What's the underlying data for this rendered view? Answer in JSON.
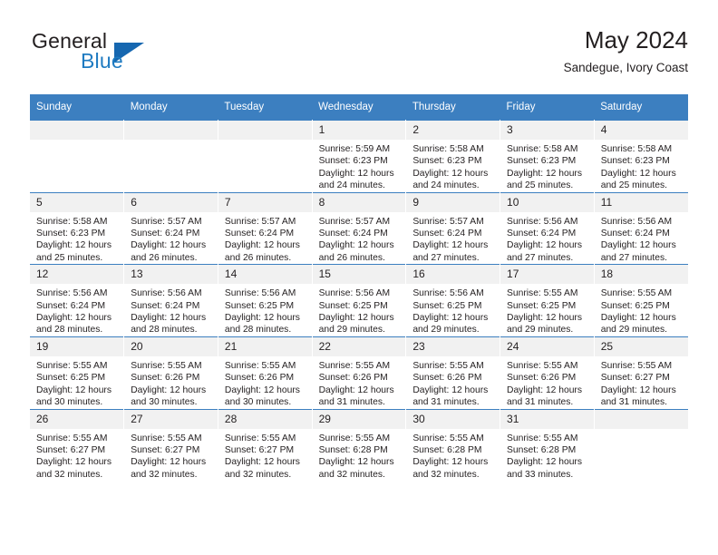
{
  "brand": {
    "name_top": "General",
    "name_bottom": "Blue",
    "accent_color": "#1f7bc1",
    "triangle_color": "#1667b0"
  },
  "header": {
    "title": "May 2024",
    "subtitle": "Sandegue, Ivory Coast"
  },
  "calendar": {
    "header_color": "#3c7fc0",
    "daynum_bg": "#f1f1f1",
    "weekday_headers": [
      "Sunday",
      "Monday",
      "Tuesday",
      "Wednesday",
      "Thursday",
      "Friday",
      "Saturday"
    ],
    "weeks": [
      [
        {
          "day": "",
          "empty": true,
          "sunrise": "",
          "sunset": "",
          "daylight_line1": "",
          "daylight_line2": ""
        },
        {
          "day": "",
          "empty": true,
          "sunrise": "",
          "sunset": "",
          "daylight_line1": "",
          "daylight_line2": ""
        },
        {
          "day": "",
          "empty": true,
          "sunrise": "",
          "sunset": "",
          "daylight_line1": "",
          "daylight_line2": ""
        },
        {
          "day": "1",
          "empty": false,
          "sunrise": "Sunrise: 5:59 AM",
          "sunset": "Sunset: 6:23 PM",
          "daylight_line1": "Daylight: 12 hours",
          "daylight_line2": "and 24 minutes."
        },
        {
          "day": "2",
          "empty": false,
          "sunrise": "Sunrise: 5:58 AM",
          "sunset": "Sunset: 6:23 PM",
          "daylight_line1": "Daylight: 12 hours",
          "daylight_line2": "and 24 minutes."
        },
        {
          "day": "3",
          "empty": false,
          "sunrise": "Sunrise: 5:58 AM",
          "sunset": "Sunset: 6:23 PM",
          "daylight_line1": "Daylight: 12 hours",
          "daylight_line2": "and 25 minutes."
        },
        {
          "day": "4",
          "empty": false,
          "sunrise": "Sunrise: 5:58 AM",
          "sunset": "Sunset: 6:23 PM",
          "daylight_line1": "Daylight: 12 hours",
          "daylight_line2": "and 25 minutes."
        }
      ],
      [
        {
          "day": "5",
          "empty": false,
          "sunrise": "Sunrise: 5:58 AM",
          "sunset": "Sunset: 6:23 PM",
          "daylight_line1": "Daylight: 12 hours",
          "daylight_line2": "and 25 minutes."
        },
        {
          "day": "6",
          "empty": false,
          "sunrise": "Sunrise: 5:57 AM",
          "sunset": "Sunset: 6:24 PM",
          "daylight_line1": "Daylight: 12 hours",
          "daylight_line2": "and 26 minutes."
        },
        {
          "day": "7",
          "empty": false,
          "sunrise": "Sunrise: 5:57 AM",
          "sunset": "Sunset: 6:24 PM",
          "daylight_line1": "Daylight: 12 hours",
          "daylight_line2": "and 26 minutes."
        },
        {
          "day": "8",
          "empty": false,
          "sunrise": "Sunrise: 5:57 AM",
          "sunset": "Sunset: 6:24 PM",
          "daylight_line1": "Daylight: 12 hours",
          "daylight_line2": "and 26 minutes."
        },
        {
          "day": "9",
          "empty": false,
          "sunrise": "Sunrise: 5:57 AM",
          "sunset": "Sunset: 6:24 PM",
          "daylight_line1": "Daylight: 12 hours",
          "daylight_line2": "and 27 minutes."
        },
        {
          "day": "10",
          "empty": false,
          "sunrise": "Sunrise: 5:56 AM",
          "sunset": "Sunset: 6:24 PM",
          "daylight_line1": "Daylight: 12 hours",
          "daylight_line2": "and 27 minutes."
        },
        {
          "day": "11",
          "empty": false,
          "sunrise": "Sunrise: 5:56 AM",
          "sunset": "Sunset: 6:24 PM",
          "daylight_line1": "Daylight: 12 hours",
          "daylight_line2": "and 27 minutes."
        }
      ],
      [
        {
          "day": "12",
          "empty": false,
          "sunrise": "Sunrise: 5:56 AM",
          "sunset": "Sunset: 6:24 PM",
          "daylight_line1": "Daylight: 12 hours",
          "daylight_line2": "and 28 minutes."
        },
        {
          "day": "13",
          "empty": false,
          "sunrise": "Sunrise: 5:56 AM",
          "sunset": "Sunset: 6:24 PM",
          "daylight_line1": "Daylight: 12 hours",
          "daylight_line2": "and 28 minutes."
        },
        {
          "day": "14",
          "empty": false,
          "sunrise": "Sunrise: 5:56 AM",
          "sunset": "Sunset: 6:25 PM",
          "daylight_line1": "Daylight: 12 hours",
          "daylight_line2": "and 28 minutes."
        },
        {
          "day": "15",
          "empty": false,
          "sunrise": "Sunrise: 5:56 AM",
          "sunset": "Sunset: 6:25 PM",
          "daylight_line1": "Daylight: 12 hours",
          "daylight_line2": "and 29 minutes."
        },
        {
          "day": "16",
          "empty": false,
          "sunrise": "Sunrise: 5:56 AM",
          "sunset": "Sunset: 6:25 PM",
          "daylight_line1": "Daylight: 12 hours",
          "daylight_line2": "and 29 minutes."
        },
        {
          "day": "17",
          "empty": false,
          "sunrise": "Sunrise: 5:55 AM",
          "sunset": "Sunset: 6:25 PM",
          "daylight_line1": "Daylight: 12 hours",
          "daylight_line2": "and 29 minutes."
        },
        {
          "day": "18",
          "empty": false,
          "sunrise": "Sunrise: 5:55 AM",
          "sunset": "Sunset: 6:25 PM",
          "daylight_line1": "Daylight: 12 hours",
          "daylight_line2": "and 29 minutes."
        }
      ],
      [
        {
          "day": "19",
          "empty": false,
          "sunrise": "Sunrise: 5:55 AM",
          "sunset": "Sunset: 6:25 PM",
          "daylight_line1": "Daylight: 12 hours",
          "daylight_line2": "and 30 minutes."
        },
        {
          "day": "20",
          "empty": false,
          "sunrise": "Sunrise: 5:55 AM",
          "sunset": "Sunset: 6:26 PM",
          "daylight_line1": "Daylight: 12 hours",
          "daylight_line2": "and 30 minutes."
        },
        {
          "day": "21",
          "empty": false,
          "sunrise": "Sunrise: 5:55 AM",
          "sunset": "Sunset: 6:26 PM",
          "daylight_line1": "Daylight: 12 hours",
          "daylight_line2": "and 30 minutes."
        },
        {
          "day": "22",
          "empty": false,
          "sunrise": "Sunrise: 5:55 AM",
          "sunset": "Sunset: 6:26 PM",
          "daylight_line1": "Daylight: 12 hours",
          "daylight_line2": "and 31 minutes."
        },
        {
          "day": "23",
          "empty": false,
          "sunrise": "Sunrise: 5:55 AM",
          "sunset": "Sunset: 6:26 PM",
          "daylight_line1": "Daylight: 12 hours",
          "daylight_line2": "and 31 minutes."
        },
        {
          "day": "24",
          "empty": false,
          "sunrise": "Sunrise: 5:55 AM",
          "sunset": "Sunset: 6:26 PM",
          "daylight_line1": "Daylight: 12 hours",
          "daylight_line2": "and 31 minutes."
        },
        {
          "day": "25",
          "empty": false,
          "sunrise": "Sunrise: 5:55 AM",
          "sunset": "Sunset: 6:27 PM",
          "daylight_line1": "Daylight: 12 hours",
          "daylight_line2": "and 31 minutes."
        }
      ],
      [
        {
          "day": "26",
          "empty": false,
          "sunrise": "Sunrise: 5:55 AM",
          "sunset": "Sunset: 6:27 PM",
          "daylight_line1": "Daylight: 12 hours",
          "daylight_line2": "and 32 minutes."
        },
        {
          "day": "27",
          "empty": false,
          "sunrise": "Sunrise: 5:55 AM",
          "sunset": "Sunset: 6:27 PM",
          "daylight_line1": "Daylight: 12 hours",
          "daylight_line2": "and 32 minutes."
        },
        {
          "day": "28",
          "empty": false,
          "sunrise": "Sunrise: 5:55 AM",
          "sunset": "Sunset: 6:27 PM",
          "daylight_line1": "Daylight: 12 hours",
          "daylight_line2": "and 32 minutes."
        },
        {
          "day": "29",
          "empty": false,
          "sunrise": "Sunrise: 5:55 AM",
          "sunset": "Sunset: 6:28 PM",
          "daylight_line1": "Daylight: 12 hours",
          "daylight_line2": "and 32 minutes."
        },
        {
          "day": "30",
          "empty": false,
          "sunrise": "Sunrise: 5:55 AM",
          "sunset": "Sunset: 6:28 PM",
          "daylight_line1": "Daylight: 12 hours",
          "daylight_line2": "and 32 minutes."
        },
        {
          "day": "31",
          "empty": false,
          "sunrise": "Sunrise: 5:55 AM",
          "sunset": "Sunset: 6:28 PM",
          "daylight_line1": "Daylight: 12 hours",
          "daylight_line2": "and 33 minutes."
        },
        {
          "day": "",
          "empty": true,
          "sunrise": "",
          "sunset": "",
          "daylight_line1": "",
          "daylight_line2": ""
        }
      ]
    ]
  }
}
